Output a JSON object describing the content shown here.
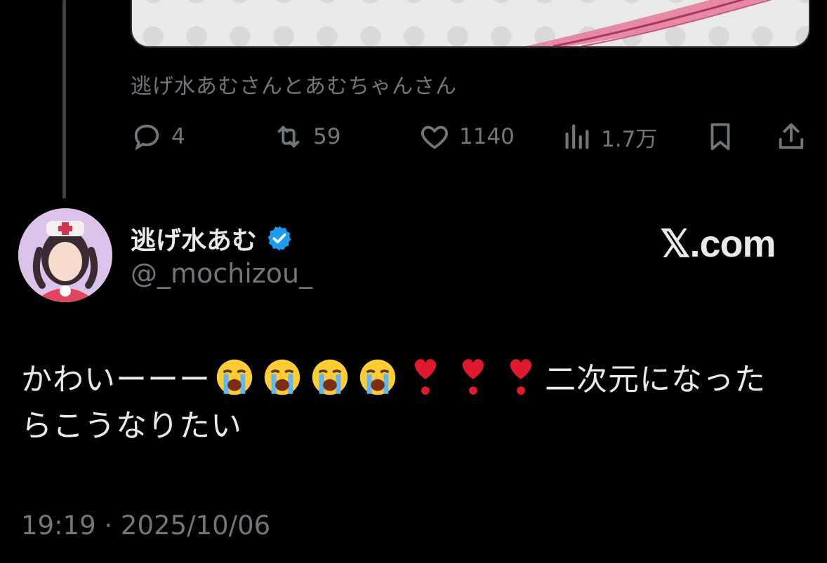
{
  "quoted": {
    "caption": "逃げ水あむさんとあむちゃんさん"
  },
  "actions": {
    "reply": {
      "icon": "reply-icon",
      "count": "4"
    },
    "repost": {
      "icon": "repost-icon",
      "count": "59"
    },
    "like": {
      "icon": "heart-icon",
      "count": "1140"
    },
    "views": {
      "icon": "views-icon",
      "count": "1.7万"
    },
    "bookmark": {
      "icon": "bookmark-icon"
    },
    "share": {
      "icon": "share-icon"
    }
  },
  "author": {
    "display_name": "逃げ水あむ",
    "handle": "@_mochizou_",
    "verified_color": "#1d9bf0"
  },
  "source_logo": "𝕏.com",
  "tweet": {
    "text_start": "かわいーーー",
    "text_end_line1": "二次元になった",
    "text_line2": "らこうなりたい",
    "emoji_crying": "loudly-crying-face",
    "emoji_heart": "heavy-heart-exclamation",
    "timestamp": "19:19 · 2025/10/06"
  }
}
